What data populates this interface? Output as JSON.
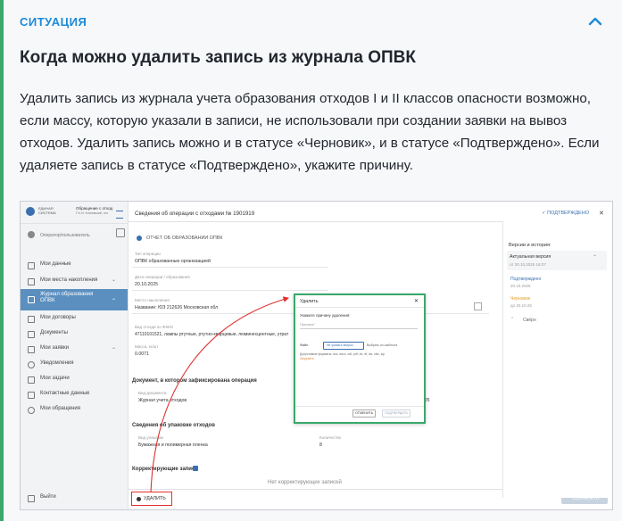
{
  "header": {
    "situation": "СИТУАЦИЯ",
    "chevron_icon": "chevron-up-icon"
  },
  "title": "Когда можно удалить запись из журнала ОПВК",
  "body": "Удалить запись из журнала учета образования отходов I и II классов опасности возможно, если массу, которую указали в записи, не использовали при создании заявки на вывоз отходов. Удалить запись можно и в статусе «Черновик», и в статусе «Подтверждено». Если удаляете запись в статусе «Подтверждено», укажите причину.",
  "colors": {
    "accent": "#1c8ad8",
    "highlight": "#3aa86b",
    "sidebar_active": "#5b8fbf",
    "arrow": "#e03030"
  },
  "screenshot": {
    "logo_text": "Обращение с отход",
    "logo_sub": "Г.Н.И. Клюевский, отх",
    "user_label": "Оператор/пользователь",
    "sidebar_items": [
      {
        "label": "Мои данные"
      },
      {
        "label": "Мои места накопления"
      },
      {
        "label": "Журнал образования ОПВК",
        "active": true
      },
      {
        "label": "Мои договоры"
      },
      {
        "label": "Документы"
      },
      {
        "label": "Мои заявки"
      },
      {
        "label": "Уведомления"
      },
      {
        "label": "Мои задачи"
      },
      {
        "label": "Контактные данные"
      },
      {
        "label": "Мои обращения"
      }
    ],
    "exit_label": "Выйти",
    "top_title": "Сведения об операции с отходами № 1901919",
    "status_confirmed": "✓ ПОДТВЕРЖДЕНО",
    "section_report": "ОТЧЕТ ОБ ОБРАЗОВАНИИ ОПВК",
    "fields": [
      {
        "label": "Тип операции",
        "value": "ОПВК образованные организацией"
      },
      {
        "label": "Дата операции / образования",
        "value": "20.10.2025"
      },
      {
        "label": "Место накопления",
        "value": "Название: ЮЗ 212626 Московская обл"
      },
      {
        "label": "Вид отхода по ФККО",
        "value": "47110101521, лампы ртутные, ртутно-кварцевые, люминесцентные, утрат"
      },
      {
        "label": "Масса, кг/шт",
        "value": "0.0071"
      }
    ],
    "doc_section": "Документ, в котором зафиксирована операция",
    "doc_field": {
      "label": "Вид документа",
      "value": "Журнал учета отходов"
    },
    "doc_date": "2025",
    "pack_section": "Сведения об упаковке отходов",
    "pack_type": {
      "label": "Вид упаковки",
      "value": "Бумажная и полимерная пленка"
    },
    "pack_qty": {
      "label": "Количество",
      "value": "8"
    },
    "corr_section": "Корректирующие записи",
    "no_corr": "Нет корректирующих записей",
    "delete_btn": "УДАЛИТЬ",
    "save_btn": "СОХРАНИТЬ",
    "versions_title": "Версии и история:",
    "versions": [
      {
        "label": "Актуальная версия",
        "date": "от 20.10.2025 16:07"
      },
      {
        "label": "Подтверждено",
        "date": "20.10.2025"
      },
      {
        "label": "Черновик",
        "date": "до 20.10.25"
      }
    ],
    "versions_more": "Свёрн",
    "modal": {
      "title": "Удалить",
      "prompt": "Укажите причину удаления:",
      "field_label": "Причина*",
      "radio_label": "Файл",
      "option1": "Не указать вопрос",
      "option2": "Выбрать из шаблона",
      "hint": "Допустимые форматы: doc, docx, odt, pdf, txt, rtf, xls, xlsx, zip",
      "upload": "Загрузить",
      "cancel_btn": "ОТМЕНИТЬ",
      "confirm_btn": "ПОДТВЕРДИТЬ"
    }
  }
}
